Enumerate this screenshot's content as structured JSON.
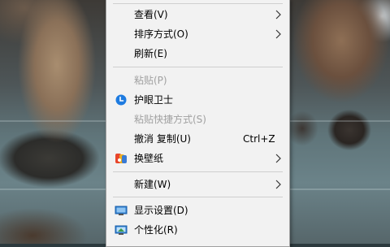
{
  "context_menu": {
    "items": [
      {
        "label": "查看(V)"
      },
      {
        "label": "排序方式(O)"
      },
      {
        "label": "刷新(E)"
      },
      {
        "label": "粘贴(P)"
      },
      {
        "label": "护眼卫士",
        "icon": "eye-guard-icon"
      },
      {
        "label": "粘贴快捷方式(S)"
      },
      {
        "label": "撤消 复制(U)",
        "shortcut": "Ctrl+Z"
      },
      {
        "label": "换壁纸",
        "icon": "wallpaper-icon"
      },
      {
        "label": "新建(W)"
      },
      {
        "label": "显示设置(D)",
        "icon": "display-settings-icon"
      },
      {
        "label": "个性化(R)",
        "icon": "personalize-icon"
      }
    ]
  },
  "colors": {
    "menu_bg": "#f2f2f2",
    "disabled_text": "#a0a0a0",
    "eye_guard_blue": "#1e7be0",
    "display_icon_blue": "#2d7fd0"
  }
}
